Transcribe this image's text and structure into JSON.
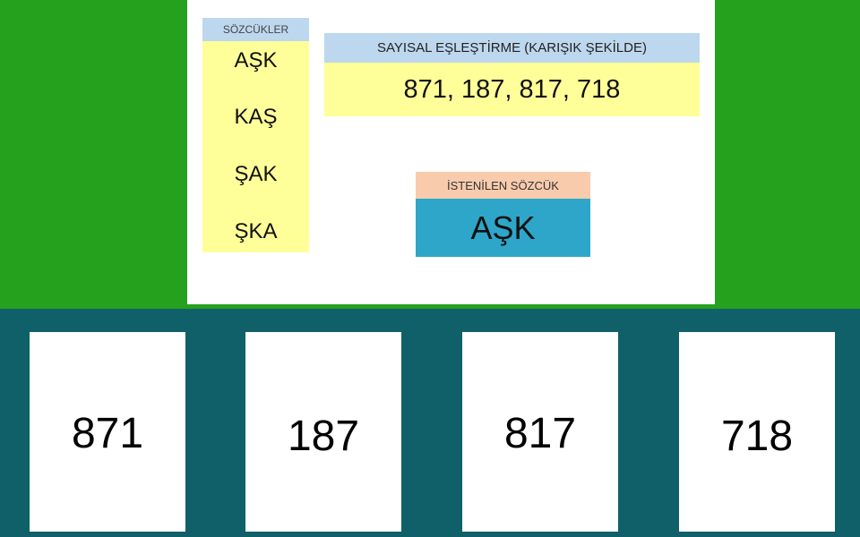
{
  "words": {
    "header": "SÖZCÜKLER",
    "items": [
      "AŞK",
      "KAŞ",
      "ŞAK",
      "ŞKA"
    ]
  },
  "mapping": {
    "header": "SAYISAL EŞLEŞTİRME (KARIŞIK ŞEKİLDE)",
    "value": "871,  187,  817, 718"
  },
  "target": {
    "header": "İSTENİLEN  SÖZCÜK",
    "word": "AŞK"
  },
  "cards": [
    "871",
    "187",
    "817",
    "718"
  ],
  "colors": {
    "top_background": "#26a11e",
    "bottom_background": "#106069",
    "header_blue": "#bdd7ee",
    "panel_yellow": "#ffff99",
    "header_peach": "#f8cbad",
    "target_blue": "#2ea6c9"
  }
}
